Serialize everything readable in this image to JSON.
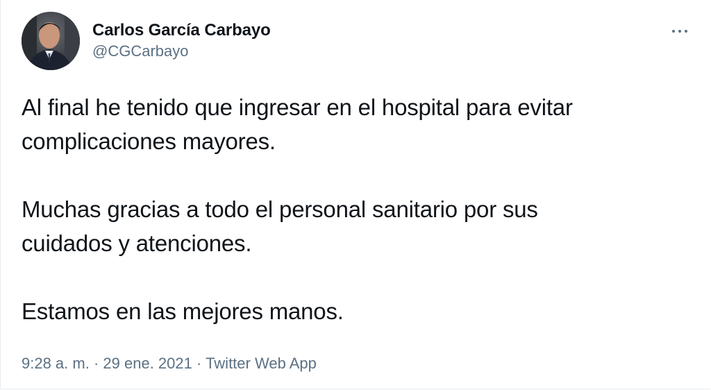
{
  "tweet": {
    "author": {
      "display_name": "Carlos García Carbayo",
      "handle": "@CGCarbayo"
    },
    "more_icon": "more-horizontal-icon",
    "text": {
      "line1": "Al final he tenido que ingresar en el hospital para evitar",
      "line2": "complicaciones mayores.",
      "line3": "Muchas gracias a todo el personal sanitario por sus",
      "line4": "cuidados y atenciones.",
      "line5": "Estamos en las mejores manos."
    },
    "meta": {
      "time": "9:28 a. m.",
      "separator": "·",
      "date": "29 ene. 2021",
      "source": "Twitter Web App"
    }
  },
  "colors": {
    "primary_text": "#0f1419",
    "secondary_text": "#5b7083",
    "border": "#e6ecf0"
  }
}
